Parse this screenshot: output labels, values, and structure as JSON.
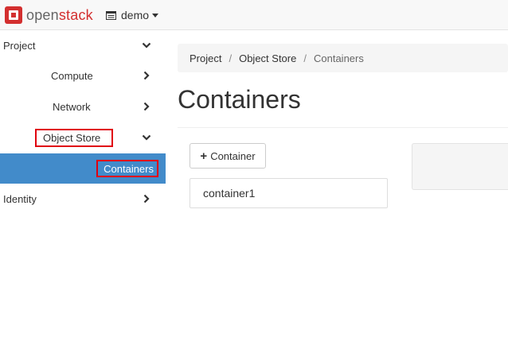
{
  "brand": {
    "open": "open",
    "stack": "stack"
  },
  "project_menu": {
    "label": "demo"
  },
  "sidebar": {
    "items": [
      {
        "label": "Project"
      },
      {
        "label": "Compute"
      },
      {
        "label": "Network"
      },
      {
        "label": "Object Store"
      },
      {
        "label": "Containers"
      },
      {
        "label": "Identity"
      }
    ]
  },
  "breadcrumb": [
    "Project",
    "Object Store",
    "Containers"
  ],
  "page": {
    "title": "Containers"
  },
  "toolbar": {
    "add_label": "Container"
  },
  "containers": [
    "container1"
  ],
  "colors": {
    "accent": "#428bca",
    "brand": "#d32f2f",
    "highlight": "#e0000f"
  }
}
